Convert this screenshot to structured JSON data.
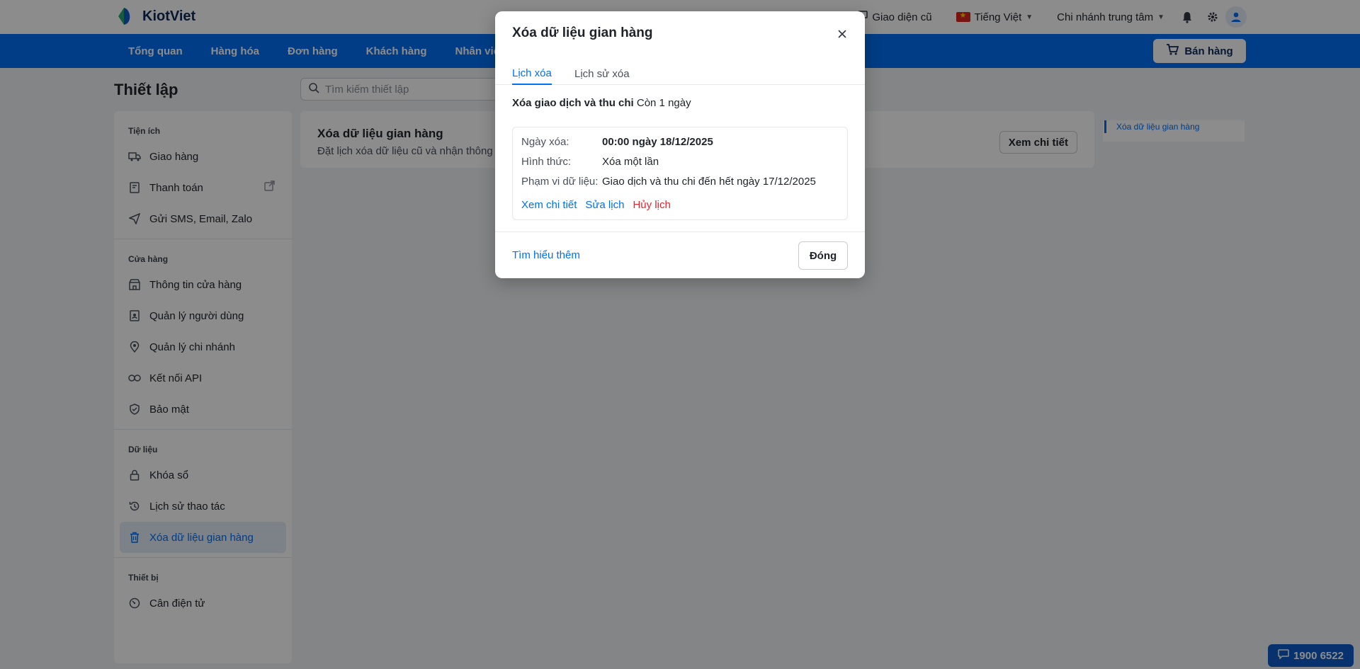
{
  "brand": {
    "name": "KiotViet",
    "colors": {
      "primary": "#0070f4",
      "logo_green": "#2aa86a",
      "logo_blue": "#0d5cc8",
      "danger": "#e5232b"
    }
  },
  "topbar": {
    "old_ui_label": "Giao diện cũ",
    "language_label": "Tiếng Việt",
    "branch_label": "Chi nhánh trung tâm",
    "icons": [
      "monitor-icon",
      "bell-icon",
      "gear-icon",
      "user-icon"
    ]
  },
  "nav": {
    "items": [
      "Tổng quan",
      "Hàng hóa",
      "Đơn hàng",
      "Khách hàng",
      "Nhân viên"
    ],
    "sell_button": "Bán hàng"
  },
  "page": {
    "title": "Thiết lập",
    "search_placeholder": "Tìm kiếm thiết lập"
  },
  "sidebar": {
    "groups": [
      {
        "heading": "Tiện ích",
        "items": [
          {
            "label": "Giao hàng",
            "icon": "truck-icon"
          },
          {
            "label": "Thanh toán",
            "icon": "payment-icon"
          },
          {
            "label": "Gửi SMS, Email, Zalo",
            "icon": "send-icon"
          }
        ]
      },
      {
        "heading": "Cửa hàng",
        "items": [
          {
            "label": "Thông tin cửa hàng",
            "icon": "store-icon"
          },
          {
            "label": "Quản lý người dùng",
            "icon": "user-badge-icon"
          },
          {
            "label": "Quản lý chi nhánh",
            "icon": "location-icon"
          },
          {
            "label": "Kết nối API",
            "icon": "link-icon"
          },
          {
            "label": "Bảo mật",
            "icon": "shield-icon"
          }
        ]
      },
      {
        "heading": "Dữ liệu",
        "items": [
          {
            "label": "Khóa sổ",
            "icon": "lock-icon"
          },
          {
            "label": "Lịch sử thao tác",
            "icon": "history-icon"
          },
          {
            "label": "Xóa dữ liệu gian hàng",
            "icon": "trash-icon",
            "active": true
          }
        ]
      },
      {
        "heading": "Thiết bị",
        "items": [
          {
            "label": "Cân điện tử",
            "icon": "scale-icon"
          }
        ]
      }
    ]
  },
  "card": {
    "title": "Xóa dữ liệu gian hàng",
    "description": "Đặt lịch xóa dữ liệu cũ và nhận thông b",
    "button": "Xem chi tiết"
  },
  "toc": {
    "item": "Xóa dữ liệu gian hàng"
  },
  "hotline": "1900 6522",
  "modal": {
    "title": "Xóa dữ liệu gian hàng",
    "tabs": [
      "Lịch xóa",
      "Lịch sử xóa"
    ],
    "summary_bold": "Xóa giao dịch và thu chi",
    "summary_rest": "Còn 1 ngày",
    "rows": [
      {
        "label": "Ngày xóa:",
        "value": "00:00 ngày 18/12/2025"
      },
      {
        "label": "Hình thức:",
        "value": "Xóa một lần"
      },
      {
        "label": "Phạm vi dữ liệu:",
        "value": "Giao dịch và thu chi đến hết ngày 17/12/2025"
      }
    ],
    "actions": {
      "detail": "Xem chi tiết",
      "edit": "Sửa lịch",
      "cancel": "Hủy lịch"
    },
    "learn_more": "Tìm hiểu thêm",
    "close_button": "Đóng"
  }
}
